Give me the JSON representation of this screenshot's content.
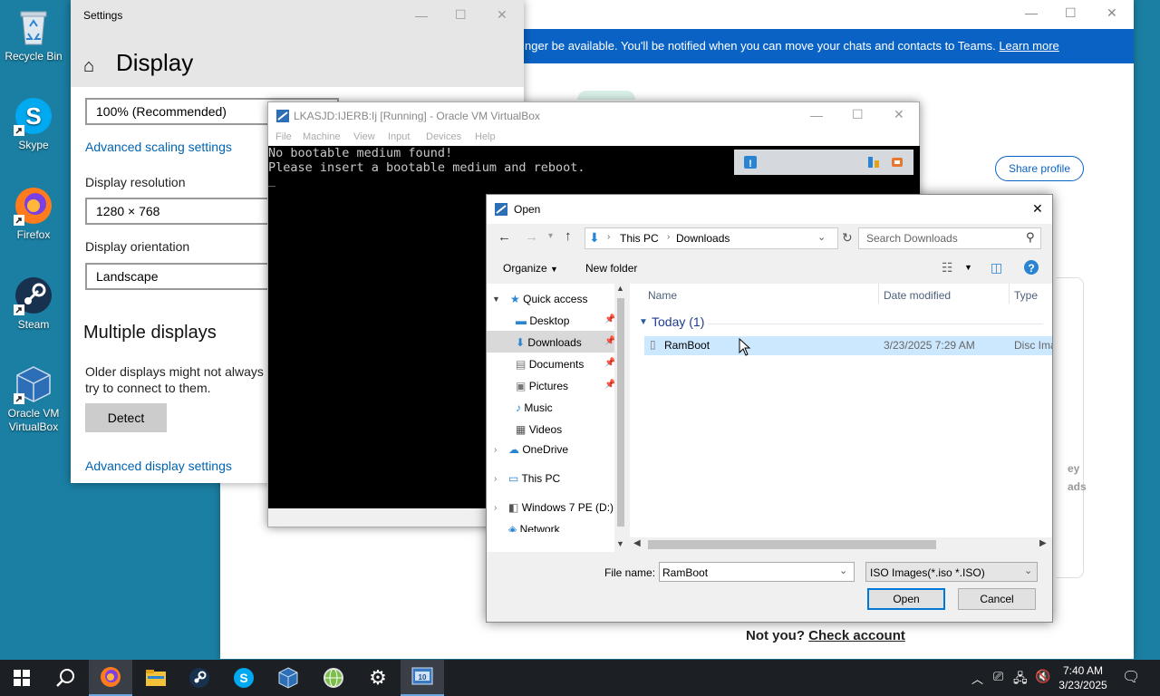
{
  "desktop": {
    "icons": [
      {
        "label": "Recycle Bin",
        "icon": "recycle-bin-icon"
      },
      {
        "label": "Skype",
        "icon": "skype-icon"
      },
      {
        "label": "Firefox",
        "icon": "firefox-icon"
      },
      {
        "label": "Steam",
        "icon": "steam-icon"
      },
      {
        "label": "Oracle VM VirtualBox",
        "icon": "virtualbox-icon"
      }
    ]
  },
  "background_window": {
    "banner_text": "nger be available. You'll be notified when you can move your chats and contacts to Teams.",
    "banner_link": "Learn more",
    "share_profile": "Share profile",
    "not_you": "Not you?",
    "check_account": "Check account",
    "right_text_1": "ey",
    "right_text_2": "ads"
  },
  "settings": {
    "window_title": "Settings",
    "page_title": "Display",
    "scale_value": "100% (Recommended)",
    "advanced_scaling": "Advanced scaling settings",
    "resolution_label": "Display resolution",
    "resolution_value": "1280 × 768",
    "orientation_label": "Display orientation",
    "orientation_value": "Landscape",
    "multiple_displays": "Multiple displays",
    "older_displays_1": "Older displays might not always",
    "older_displays_2": "try to connect to them.",
    "detect": "Detect",
    "advanced_display": "Advanced display settings"
  },
  "vbox": {
    "title": "LKASJD:IJERB:Ij [Running] - Oracle VM VirtualBox",
    "menu": [
      "File",
      "Machine",
      "View",
      "Input",
      "Devices",
      "Help"
    ],
    "console_line_1": "No bootable medium found!",
    "console_line_2": "Please insert a bootable medium and reboot.",
    "console_cursor": "_"
  },
  "open_dialog": {
    "title": "Open",
    "breadcrumb": [
      "This PC",
      "Downloads"
    ],
    "search_placeholder": "Search Downloads",
    "organize": "Organize",
    "new_folder": "New folder",
    "nav": [
      {
        "label": "Quick access",
        "icon": "star-icon"
      },
      {
        "label": "Desktop",
        "icon": "desktop-icon"
      },
      {
        "label": "Downloads",
        "icon": "download-icon"
      },
      {
        "label": "Documents",
        "icon": "document-icon"
      },
      {
        "label": "Pictures",
        "icon": "picture-icon"
      },
      {
        "label": "Music",
        "icon": "music-icon"
      },
      {
        "label": "Videos",
        "icon": "video-icon"
      },
      {
        "label": "OneDrive",
        "icon": "cloud-icon"
      },
      {
        "label": "This PC",
        "icon": "computer-icon"
      },
      {
        "label": "Windows 7 PE (D:)",
        "icon": "drive-icon"
      },
      {
        "label": "Network",
        "icon": "network-icon"
      }
    ],
    "columns": [
      "Name",
      "Date modified",
      "Type"
    ],
    "group": "Today (1)",
    "file": {
      "name": "RamBoot",
      "date": "3/23/2025 7:29 AM",
      "type": "Disc Ima"
    },
    "file_name_label": "File name:",
    "file_name_value": "RamBoot",
    "filter": "ISO Images(*.iso *.ISO)",
    "open_button": "Open",
    "cancel_button": "Cancel"
  },
  "taskbar": {
    "time": "7:40 AM",
    "date": "3/23/2025"
  },
  "colors": {
    "desktop": "#1b7fa3",
    "accent": "#0a63c4",
    "link": "#0063b1",
    "taskbar": "#1c1f24"
  }
}
